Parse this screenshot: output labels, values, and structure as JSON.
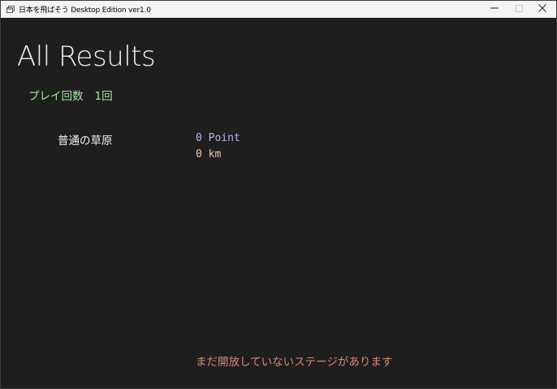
{
  "window": {
    "title": "日本を飛ばそう Desktop Edition ver1.0",
    "icon": "app-window-icon",
    "controls": {
      "minimize_icon": "minimize-icon",
      "maximize_icon": "maximize-icon",
      "close_icon": "close-icon"
    }
  },
  "page": {
    "title": "All Results",
    "play_count_label": "プレイ回数",
    "play_count_value": "1回"
  },
  "stages": [
    {
      "name": "普通の草原",
      "points": "0 Point",
      "distance": "0 km"
    }
  ],
  "notice": "まだ開放していないステージがあります",
  "colors": {
    "background": "#1e1e1e",
    "title_text": "#f0f0f0",
    "play_count": "#a8e6a0",
    "points": "#b6b6f0",
    "distance": "#f0c8a8",
    "notice": "#d8877a"
  }
}
